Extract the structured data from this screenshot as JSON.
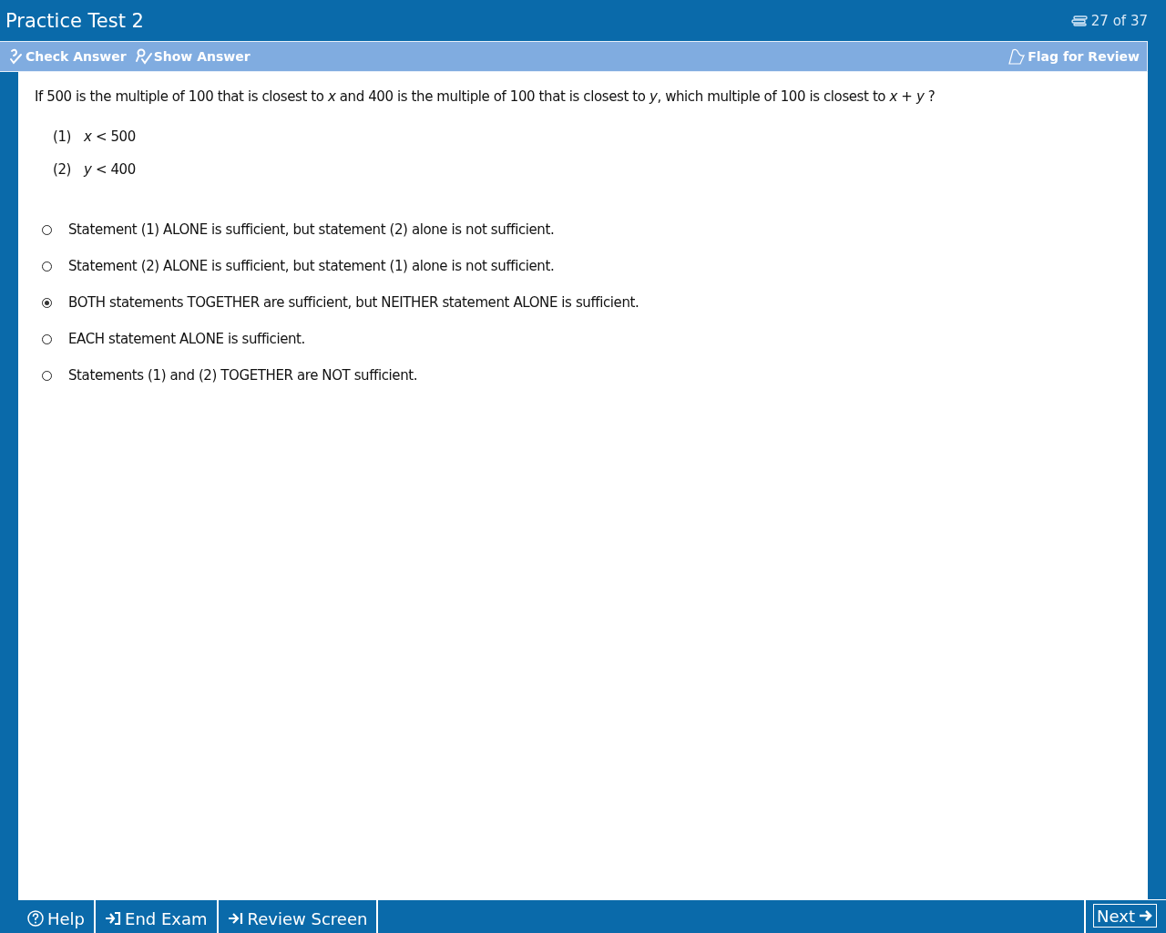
{
  "window": {
    "title": "Practice Test 2",
    "progress": "27 of 37"
  },
  "toolbar": {
    "left": [
      {
        "label": "Check Answer",
        "kind": "check"
      },
      {
        "label": "Show Answer",
        "kind": "show"
      }
    ],
    "right": {
      "label": "Flag for Review",
      "kind": "flag"
    }
  },
  "question": {
    "stem": "If 500 is the multiple of 100 that is closest to *x* and 400 is the multiple of 100 that is closest to *y*, which multiple of 100 is closest to *x* + *y* ?",
    "statements": [
      {
        "number": "(1)",
        "text": "*x* < 500"
      },
      {
        "number": "(2)",
        "text": "*y* < 400"
      }
    ]
  },
  "choices": [
    {
      "label": "Statement (1) ALONE is sufficient, but statement (2) alone is not sufficient.",
      "selected": false
    },
    {
      "label": "Statement (2) ALONE is sufficient, but statement (1) alone is not sufficient.",
      "selected": false
    },
    {
      "label": "BOTH statements TOGETHER are sufficient, but NEITHER statement ALONE is sufficient.",
      "selected": true
    },
    {
      "label": "EACH statement ALONE is sufficient.",
      "selected": false
    },
    {
      "label": "Statements (1) and (2) TOGETHER are NOT sufficient.",
      "selected": false
    }
  ],
  "footer": {
    "left": [
      {
        "label": "Help",
        "kind": "help"
      },
      {
        "label": "End Exam",
        "kind": "end"
      },
      {
        "label": "Review Screen",
        "kind": "review"
      }
    ],
    "right": {
      "label": "Next",
      "kind": "next"
    }
  }
}
